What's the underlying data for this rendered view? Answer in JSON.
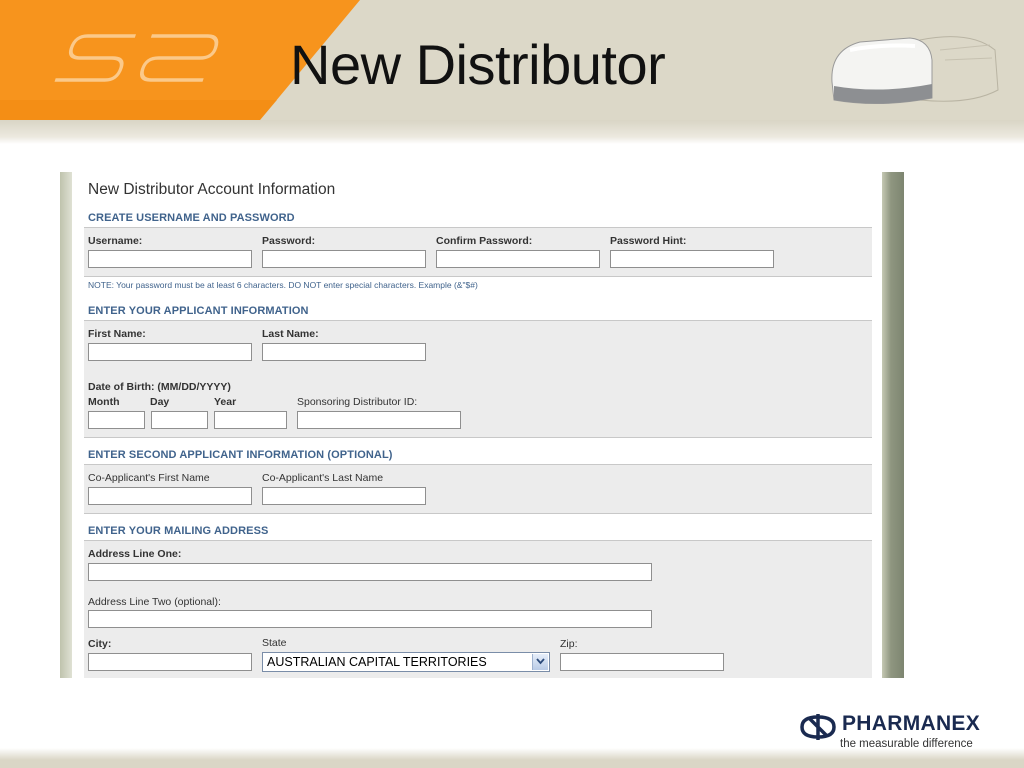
{
  "slide": {
    "title": "New Distributor",
    "logo_text": "S2"
  },
  "brand": {
    "name": "PHARMANEX",
    "tagline": "the measurable difference",
    "accent_orange": "#f7941d",
    "header_beige": "#dcd8c8",
    "link_blue": "#40638c"
  },
  "form": {
    "heading": "New Distributor Account Information",
    "account": {
      "section_title": "CREATE USERNAME AND PASSWORD",
      "username_label": "Username:",
      "password_label": "Password:",
      "confirm_password_label": "Confirm Password:",
      "password_hint_label": "Password Hint:",
      "username_value": "",
      "password_value": "",
      "confirm_password_value": "",
      "password_hint_value": "",
      "note": "NOTE: Your password must be at least 6 characters. DO NOT enter special characters. Example (&\"$#)"
    },
    "applicant": {
      "section_title": "ENTER YOUR APPLICANT INFORMATION",
      "first_name_label": "First Name:",
      "last_name_label": "Last Name:",
      "dob_label": "Date of Birth: (MM/DD/YYYY)",
      "month_label": "Month",
      "day_label": "Day",
      "year_label": "Year",
      "sponsor_label": "Sponsoring Distributor ID:"
    },
    "co_applicant": {
      "section_title": "ENTER SECOND APPLICANT INFORMATION (OPTIONAL)",
      "first_name_label": "Co-Applicant's First Name",
      "last_name_label": "Co-Applicant's Last Name"
    },
    "mailing": {
      "section_title": "ENTER YOUR MAILING ADDRESS",
      "address_one_label": "Address Line One:",
      "address_two_label": "Address Line Two (optional):",
      "city_label": "City:",
      "state_label": "State",
      "state_value": "AUSTRALIAN CAPITAL TERRITORIES",
      "zip_label": "Zip:"
    }
  },
  "icons": {
    "dropdown": "chevron-down-icon",
    "brand_mark": "pharmanex-logo-icon",
    "device": "device-image"
  }
}
